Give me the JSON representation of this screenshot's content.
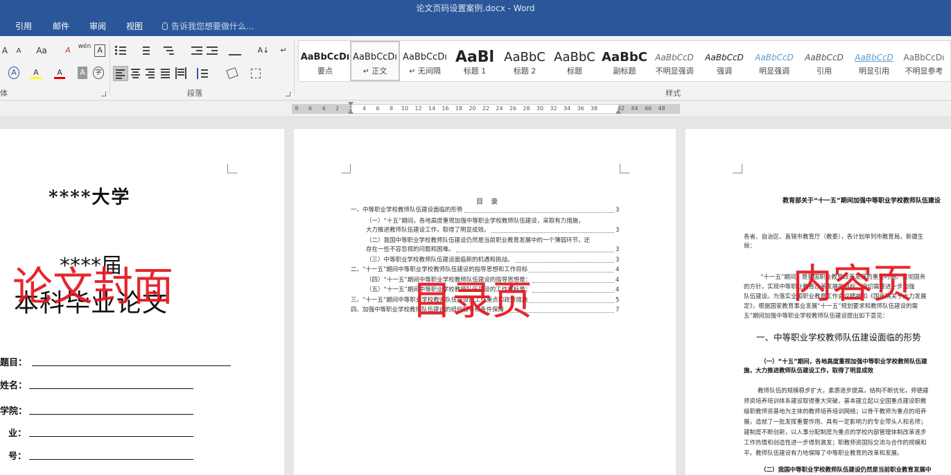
{
  "window": {
    "title": "论文页码设置案例.docx - Word"
  },
  "tabs": [
    "引用",
    "邮件",
    "审阅",
    "视图"
  ],
  "tell_me": {
    "placeholder": "告诉我您想要做什么..."
  },
  "ribbon": {
    "font_group_label": "体",
    "paragraph_group_label": "段落",
    "styles_group_label": "样式",
    "font_buttons": {
      "grow": "A",
      "shrink": "A",
      "case": "Aa",
      "clear": "A",
      "phonetic": "wén",
      "border": "A",
      "effect": "A",
      "highlight": "A",
      "color": "A",
      "shade": "A",
      "enclose": "字"
    },
    "paragraph_buttons": {
      "sort": "A↓",
      "pilcrow": "↵"
    },
    "styles": [
      {
        "preview": "AaBbCcDı",
        "name": "要点"
      },
      {
        "preview": "AaBbCcDı",
        "name": "↵ 正文"
      },
      {
        "preview": "AaBbCcDı",
        "name": "↵ 无间隔"
      },
      {
        "preview": "AaBl",
        "name": "标题 1"
      },
      {
        "preview": "AaBbC",
        "name": "标题 2"
      },
      {
        "preview": "AaBbC",
        "name": "标题"
      },
      {
        "preview": "AaBbC",
        "name": "副标题"
      },
      {
        "preview": "AaBbCcD",
        "name": "不明显强调"
      },
      {
        "preview": "AaBbCcD",
        "name": "强调"
      },
      {
        "preview": "AaBbCcD",
        "name": "明显强调"
      },
      {
        "preview": "AaBbCcD",
        "name": "引用"
      },
      {
        "preview": "AaBbCcD",
        "name": "明显引用"
      },
      {
        "preview": "AaBbCcDı",
        "name": "不明显参考"
      }
    ],
    "selected_style": "正文"
  },
  "ruler": {
    "ticks": [
      "8",
      "6",
      "4",
      "2",
      "2",
      "4",
      "6",
      "8",
      "10",
      "12",
      "14",
      "16",
      "18",
      "20",
      "22",
      "24",
      "26",
      "28",
      "30",
      "32",
      "34",
      "36",
      "38",
      "42",
      "44",
      "46",
      "48"
    ]
  },
  "cover_page": {
    "university": "****大学",
    "session": "****届",
    "thesis": "本科毕业论文",
    "label": "论文封面",
    "fields": [
      "题目：",
      "姓名：",
      "学院：",
      "业：",
      "号："
    ]
  },
  "toc_page": {
    "title": "目 录",
    "label": "目录页",
    "entries": [
      {
        "text": "一、中等职业学校教师队伍建设面临的形势",
        "page": "3"
      },
      {
        "text": "（一）“十五”期间，各地高度重视加强中等职业学校教师队伍建设，采取有力措施，",
        "page": ""
      },
      {
        "text": "大力推进教师队伍建设工作，取得了明显成效。",
        "page": "3"
      },
      {
        "text": "（二）我国中等职业学校教师队伍建设仍然是当前职业教育发展中的一个薄弱环节，还",
        "page": ""
      },
      {
        "text": "存在一些不容忽视的问题和困难。",
        "page": "3"
      },
      {
        "text": "（三）中等职业学校教师队伍建设面临新的机遇和挑战。",
        "page": "3"
      },
      {
        "text": "二、“十一五”期间中等职业学校教师队伍建设的指导思想和工作目标",
        "page": "4"
      },
      {
        "text": "（四）“十一五”期间中等职业学校教师队伍建设的指导思想是：",
        "page": "4"
      },
      {
        "text": "（五）“十一五”期间中等职业学校教师队伍建设的工作目标是：",
        "page": "4"
      },
      {
        "text": "三、“十一五”期间中等职业学校教师队伍建设的工作重点和政策措施",
        "page": "5"
      },
      {
        "text": "四、加强中等职业学校教师队伍建设的组织领导和条件保障",
        "page": "7"
      }
    ]
  },
  "content_page": {
    "title": "教育部关于“十一五”期间加强中等职业学校教师队伍建设",
    "label": "内容页",
    "salutation": [
      "各省、自治区、直辖市教育厅（教委），各计划单列市教育局，新疆生",
      "局："
    ],
    "intro": [
      "“十一五”期间，是我国职业教育改革发展的重要时期。贯彻国务",
      "的方针，实现中等职业教育改革发展的目标，迫切需要进一步加强",
      "队伍建设。为落实全国职业教育工作会议精神和《国务院关于大力发展",
      "定》，根据国家教育事业发展“十一五”规划要求和教师队伍建设的需",
      "五”期间加强中等职业学校教师队伍建设提出如下意见："
    ],
    "heading1": "一、中等职业学校教师队伍建设面临的形势",
    "heading2a": [
      "（一）“十五”期间，各地高度重视加强中等职业学校教师队伍建",
      "施，大力推进教师队伍建设工作，取得了明显成效"
    ],
    "body": [
      "教师队伍的规模稳步扩大，素质逐步提高，结构不断优化，师德建",
      "师资培养培训体系建设取得重大突破，基本建立起以全国重点建设职教",
      "级职教师资基地为主体的教师培养培训网络；以骨干教师为重点的培养",
      "展，造就了一批发挥重要作用、具有一定影响力的专业带头人和名师；",
      "建制度不断创新，以人事分配制度为重点的学校内部管理体制改革逐步",
      "工作热情和创造性进一步得到激发；职教师资国际交流与合作的规模和",
      "平。教师队伍建设有力地保障了中等职业教育的改革和发展。"
    ],
    "heading2b": "（二）我国中等职业学校教师队伍建设仍然是当前职业教育发展中"
  }
}
